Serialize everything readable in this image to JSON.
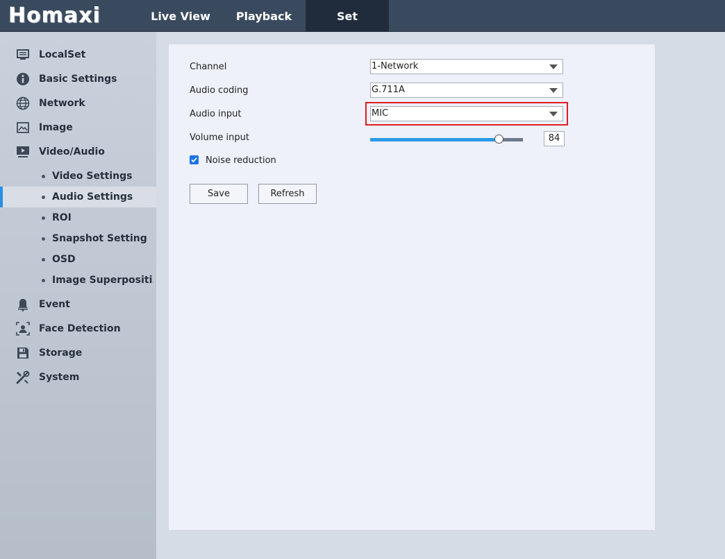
{
  "header": {
    "logo": "Homaxi",
    "tabs": [
      {
        "label": "Live View"
      },
      {
        "label": "Playback"
      },
      {
        "label": "Set"
      }
    ]
  },
  "sidebar": {
    "items": [
      {
        "label": "LocalSet",
        "icon": "monitor-icon"
      },
      {
        "label": "Basic Settings",
        "icon": "info-icon"
      },
      {
        "label": "Network",
        "icon": "globe-icon"
      },
      {
        "label": "Image",
        "icon": "image-icon"
      },
      {
        "label": "Video/Audio",
        "icon": "video-icon"
      },
      {
        "label": "Event",
        "icon": "bell-icon"
      },
      {
        "label": "Face Detection",
        "icon": "face-detection-icon"
      },
      {
        "label": "Storage",
        "icon": "floppy-disk-icon"
      },
      {
        "label": "System",
        "icon": "tools-icon"
      }
    ],
    "subitems": [
      {
        "label": "Video Settings"
      },
      {
        "label": "Audio Settings"
      },
      {
        "label": "ROI"
      },
      {
        "label": "Snapshot Setting"
      },
      {
        "label": "OSD"
      },
      {
        "label": "Image Superpositi..."
      }
    ]
  },
  "form": {
    "channel_label": "Channel",
    "channel_value": "1-Network",
    "audio_coding_label": "Audio coding",
    "audio_coding_value": "G.711A",
    "audio_input_label": "Audio input",
    "audio_input_value": "MIC",
    "volume_label": "Volume input",
    "volume_value": "84",
    "volume_fraction": 0.84,
    "noise_reduction_label": "Noise reduction",
    "noise_reduction_checked": true,
    "save_label": "Save",
    "refresh_label": "Refresh"
  },
  "colors": {
    "accent": "#2b9be9",
    "highlight": "#e11b22",
    "topbar": "#3a4a5e",
    "active_tab": "#202c3c"
  }
}
